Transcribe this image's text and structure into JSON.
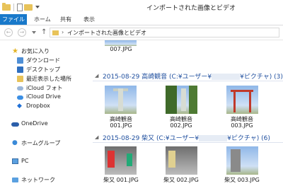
{
  "window": {
    "title": "インポートされた画像とビデオ"
  },
  "ribbon": {
    "tabs": [
      "ファイル",
      "ホーム",
      "共有",
      "表示"
    ]
  },
  "address": {
    "path": "インポートされた画像とビデオ"
  },
  "sidebar": {
    "favorites_label": "お気に入り",
    "items": [
      "ダウンロード",
      "デスクトップ",
      "最近表示した場所",
      "iCloud フォト",
      "iCloud Drive",
      "Dropbox"
    ],
    "onedrive": "OneDrive",
    "homegroup": "ホームグループ",
    "pc": "PC",
    "network": "ネットワーク"
  },
  "content": {
    "top_item_label": "007.JPG",
    "groups": [
      {
        "header_prefix": "2015-08-29 高崎観音 (C:¥ユーザー¥",
        "header_suffix": "¥ピクチャ) (3)",
        "items": [
          {
            "label_line1": "高崎観音",
            "label_line2": "001.JPG"
          },
          {
            "label_line1": "高崎観音",
            "label_line2": "002.JPG"
          },
          {
            "label_line1": "高崎観音",
            "label_line2": "003.JPG"
          }
        ]
      },
      {
        "header_prefix": "2015-08-29 柴又 (C:¥ユーザー¥",
        "header_suffix": "¥ピクチャ) (6)",
        "items": [
          {
            "label": "柴又 001.JPG"
          },
          {
            "label": "柴又 002.JPG"
          },
          {
            "label": "柴又 003.JPG"
          }
        ]
      }
    ]
  }
}
